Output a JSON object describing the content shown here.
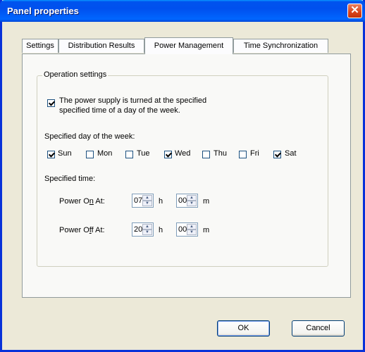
{
  "window": {
    "title": "Panel properties"
  },
  "tabs": [
    {
      "label": "Settings"
    },
    {
      "label": "Distribution Results"
    },
    {
      "label": "Power Management"
    },
    {
      "label": "Time Synchronization"
    }
  ],
  "active_tab": "Power Management",
  "group": {
    "label": "Operation settings"
  },
  "power_checkbox": {
    "checked": true,
    "line1": "The power supply is turned at the specified",
    "line2": "specified time of a day of the week."
  },
  "days": {
    "label": "Specified day of the week:",
    "items": [
      {
        "label": "Sun",
        "checked": true
      },
      {
        "label": "Mon",
        "checked": false
      },
      {
        "label": "Tue",
        "checked": false
      },
      {
        "label": "Wed",
        "checked": true
      },
      {
        "label": "Thu",
        "checked": false
      },
      {
        "label": "Fri",
        "checked": false
      },
      {
        "label": "Sat",
        "checked": true
      }
    ]
  },
  "time": {
    "label": "Specified time:",
    "power_on": {
      "label_prefix": "Power O",
      "label_accel": "n",
      "label_suffix": " At:",
      "hour": "07",
      "minute": "00"
    },
    "power_off": {
      "label_prefix": "Power O",
      "label_accel": "f",
      "label_suffix": "f At:",
      "hour": "20",
      "minute": "00"
    },
    "hour_unit": "h",
    "minute_unit": "m"
  },
  "buttons": {
    "ok": "OK",
    "cancel": "Cancel"
  }
}
